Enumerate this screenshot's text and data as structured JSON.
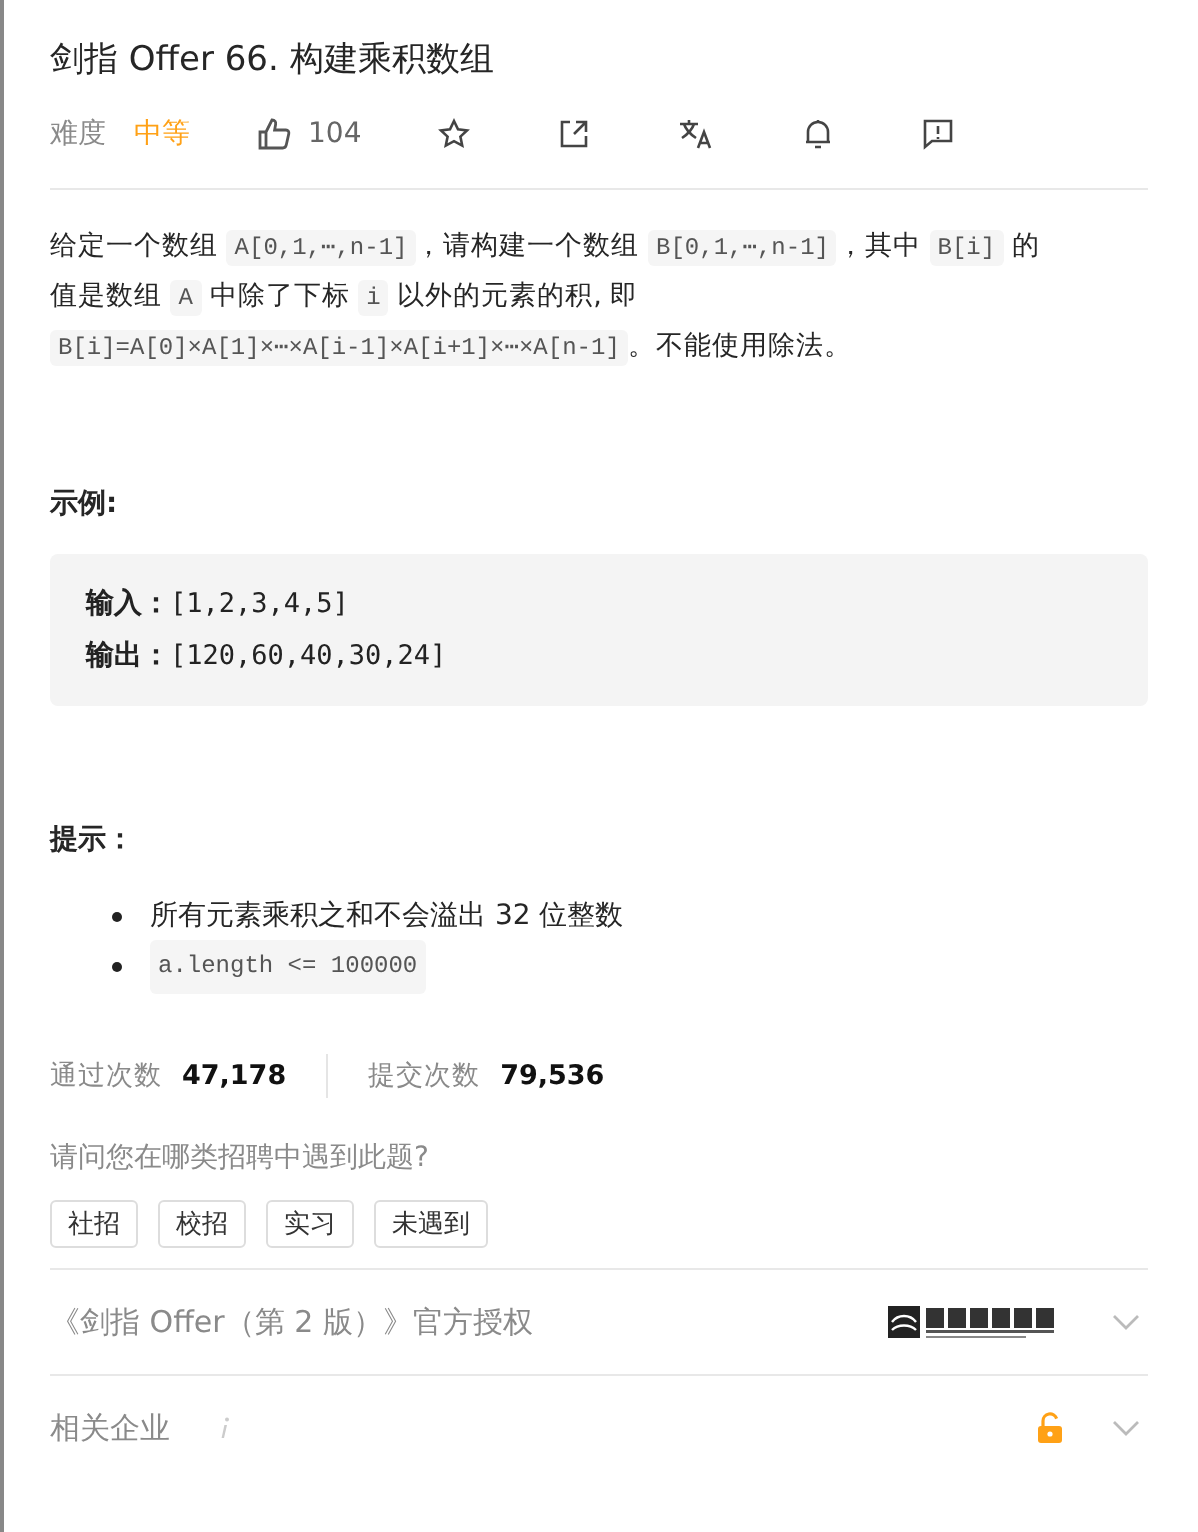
{
  "title": "剑指 Offer 66. 构建乘积数组",
  "meta": {
    "difficulty_label": "难度",
    "difficulty": {
      "text": "中等",
      "color": "#ffa116"
    },
    "likes": "104"
  },
  "description": [
    {
      "kind": "text",
      "text": "给定一个数组 "
    },
    {
      "kind": "code",
      "text": "A[0,1,⋯,n-1]"
    },
    {
      "kind": "text",
      "text": "，请构建一个数组 "
    },
    {
      "kind": "code",
      "text": "B[0,1,⋯,n-1]"
    },
    {
      "kind": "text",
      "text": "，其中 "
    },
    {
      "kind": "code",
      "text": "B[i]"
    },
    {
      "kind": "text",
      "text": " 的值是数组 "
    },
    {
      "kind": "code",
      "text": "A"
    },
    {
      "kind": "text",
      "text": " 中除了下标 "
    },
    {
      "kind": "code",
      "text": "i"
    },
    {
      "kind": "text",
      "text": " 以外的元素的积, 即 "
    },
    {
      "kind": "code",
      "text": "B[i]=A[0]×A[1]×⋯×A[i-1]×A[i+1]×⋯×A[n-1]"
    },
    {
      "kind": "text",
      "text": "。不能使用除法。"
    }
  ],
  "example": {
    "heading": "示例:",
    "lines": [
      {
        "label": "输入：",
        "value": "[1,2,3,4,5]"
      },
      {
        "label": "输出：",
        "value": "[120,60,40,30,24]"
      }
    ]
  },
  "hints": {
    "heading": "提示：",
    "items": [
      {
        "kind": "text",
        "text": "所有元素乘积之和不会溢出 32 位整数"
      },
      {
        "kind": "code",
        "text": "a.length <= 100000"
      }
    ]
  },
  "stats": [
    {
      "label": "通过次数",
      "value": "47,178"
    },
    {
      "label": "提交次数",
      "value": "79,536"
    }
  ],
  "survey": {
    "question": "请问您在哪类招聘中遇到此题?",
    "options": [
      "社招",
      "校招",
      "实习",
      "未遇到"
    ]
  },
  "sections": [
    {
      "kind": "publisher",
      "title": "《剑指 Offer（第 2 版）》官方授权",
      "expanded": false
    },
    {
      "kind": "companies",
      "title": "相关企业",
      "expanded": false,
      "locked": false
    }
  ]
}
